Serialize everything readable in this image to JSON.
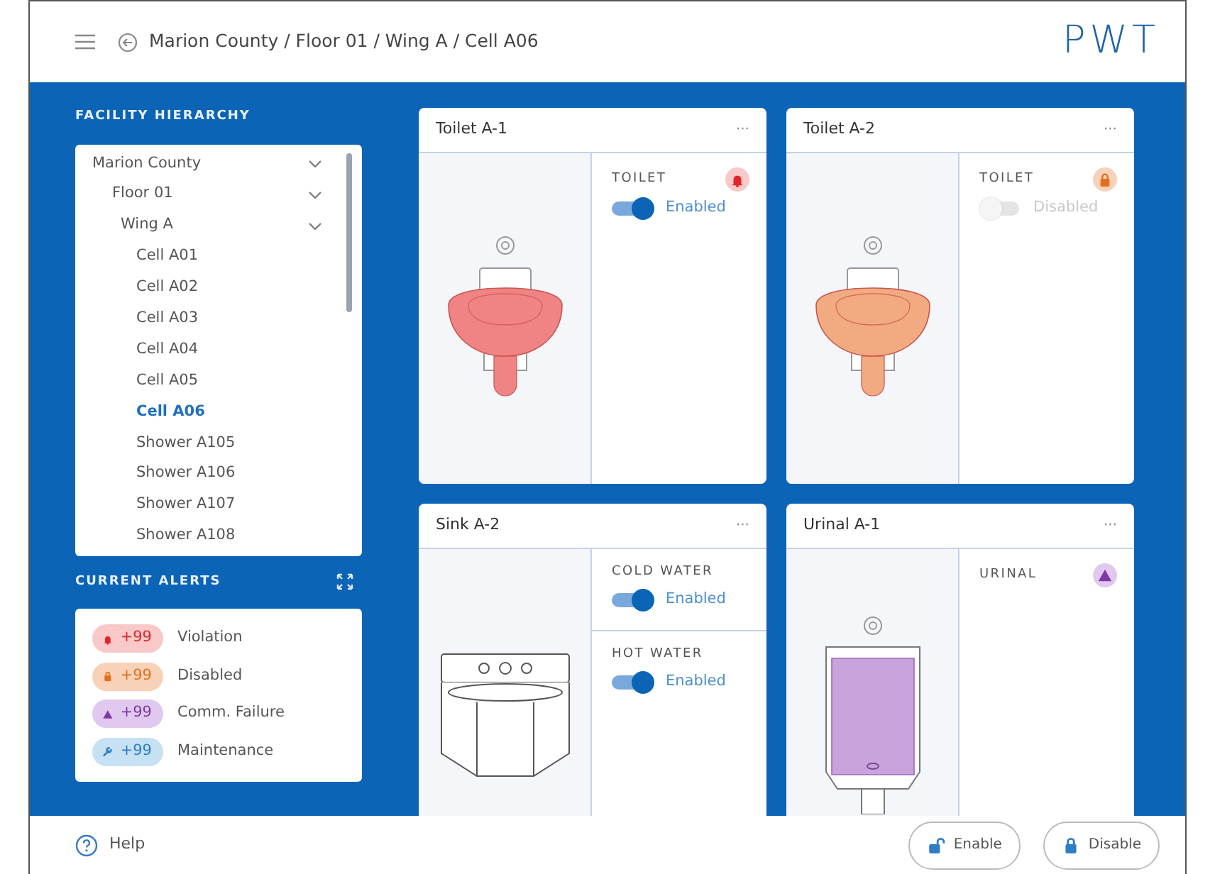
{
  "header": {
    "breadcrumb": "Marion County / Floor 01 / Wing A / Cell A06",
    "logo": "PWT"
  },
  "hierarchy": {
    "title": "FACILITY HIERARCHY",
    "tree": [
      {
        "label": "Marion County",
        "expanded": true,
        "selected": false,
        "children": [
          {
            "label": "Floor 01",
            "expanded": true,
            "selected": false,
            "children": [
              {
                "label": "Wing A",
                "expanded": true,
                "selected": false,
                "children": [
                  {
                    "label": "Cell A01",
                    "selected": false
                  },
                  {
                    "label": "Cell A02",
                    "selected": false
                  },
                  {
                    "label": "Cell A03",
                    "selected": false
                  },
                  {
                    "label": "Cell A04",
                    "selected": false
                  },
                  {
                    "label": "Cell A05",
                    "selected": false
                  },
                  {
                    "label": "Cell A06",
                    "selected": true
                  },
                  {
                    "label": "Shower A105",
                    "selected": false
                  },
                  {
                    "label": "Shower A106",
                    "selected": false
                  },
                  {
                    "label": "Shower A107",
                    "selected": false
                  },
                  {
                    "label": "Shower A108",
                    "selected": false
                  }
                ]
              }
            ]
          }
        ]
      }
    ]
  },
  "alerts": {
    "title": "CURRENT ALERTS",
    "items": [
      {
        "kind": "violation",
        "count": "+99",
        "label": "Violation"
      },
      {
        "kind": "disabled",
        "count": "+99",
        "label": "Disabled"
      },
      {
        "kind": "comm_failure",
        "count": "+99",
        "label": "Comm. Failure"
      },
      {
        "kind": "maintenance",
        "count": "+99",
        "label": "Maintenance"
      }
    ]
  },
  "devices": [
    {
      "name": "Toilet A-1",
      "menu": "···",
      "kind": "toilet",
      "color": "#f08485",
      "alert": {
        "kind": "violation"
      },
      "controls": [
        {
          "label": "TOILET",
          "on": true,
          "text": "Enabled"
        }
      ]
    },
    {
      "name": "Toilet A-2",
      "menu": "···",
      "kind": "toilet",
      "color": "#f2ab80",
      "alert": {
        "kind": "disabled"
      },
      "controls": [
        {
          "label": "TOILET",
          "on": false,
          "text": "Disabled"
        }
      ]
    },
    {
      "name": "Sink A-2",
      "menu": "···",
      "kind": "sink",
      "controls": [
        {
          "label": "COLD WATER",
          "on": true,
          "text": "Enabled"
        },
        {
          "label": "HOT WATER",
          "on": true,
          "text": "Enabled"
        }
      ]
    },
    {
      "name": "Urinal A-1",
      "menu": "···",
      "kind": "urinal",
      "color": "#c9a3dc",
      "alert": {
        "kind": "comm_failure"
      },
      "controls": [
        {
          "label": "URINAL"
        }
      ]
    }
  ],
  "footer": {
    "help": "Help",
    "buttons": [
      {
        "kind": "enable",
        "label": "Enable"
      },
      {
        "kind": "disable",
        "label": "Disable"
      }
    ]
  }
}
